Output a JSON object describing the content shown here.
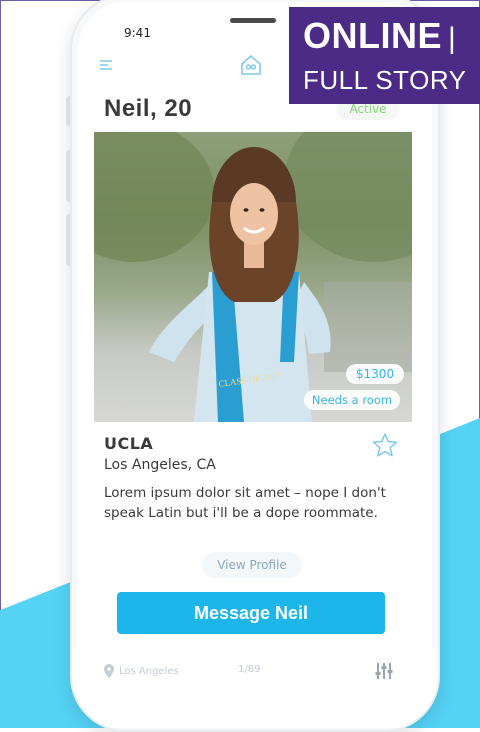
{
  "status": {
    "time": "9:41"
  },
  "profile": {
    "title": "Neil, 20",
    "status_badge": "Active",
    "price": "$1300",
    "housing_status": "Needs a room",
    "school": "UCLA",
    "location": "Los Angeles, CA",
    "bio": "Lorem ipsum dolor sit amet – nope I don't speak Latin but i'll be a dope roommate.",
    "photo_sash_text": "CLASS OF 2017"
  },
  "actions": {
    "view_profile_label": "View Profile",
    "message_label": "Message Neil"
  },
  "bottom_bar": {
    "location": "Los Angeles",
    "pager": "1/89"
  },
  "banner": {
    "top": "ONLINE",
    "separator": "|",
    "bottom": "FULL STORY"
  },
  "colors": {
    "accent": "#1db6ea",
    "wave": "#55d2f4",
    "active_green": "#86d67a",
    "banner_purple": "#4b2b85"
  },
  "icons": [
    "menu-icon",
    "home-icon",
    "star-icon",
    "pin-icon",
    "filter-icon"
  ]
}
